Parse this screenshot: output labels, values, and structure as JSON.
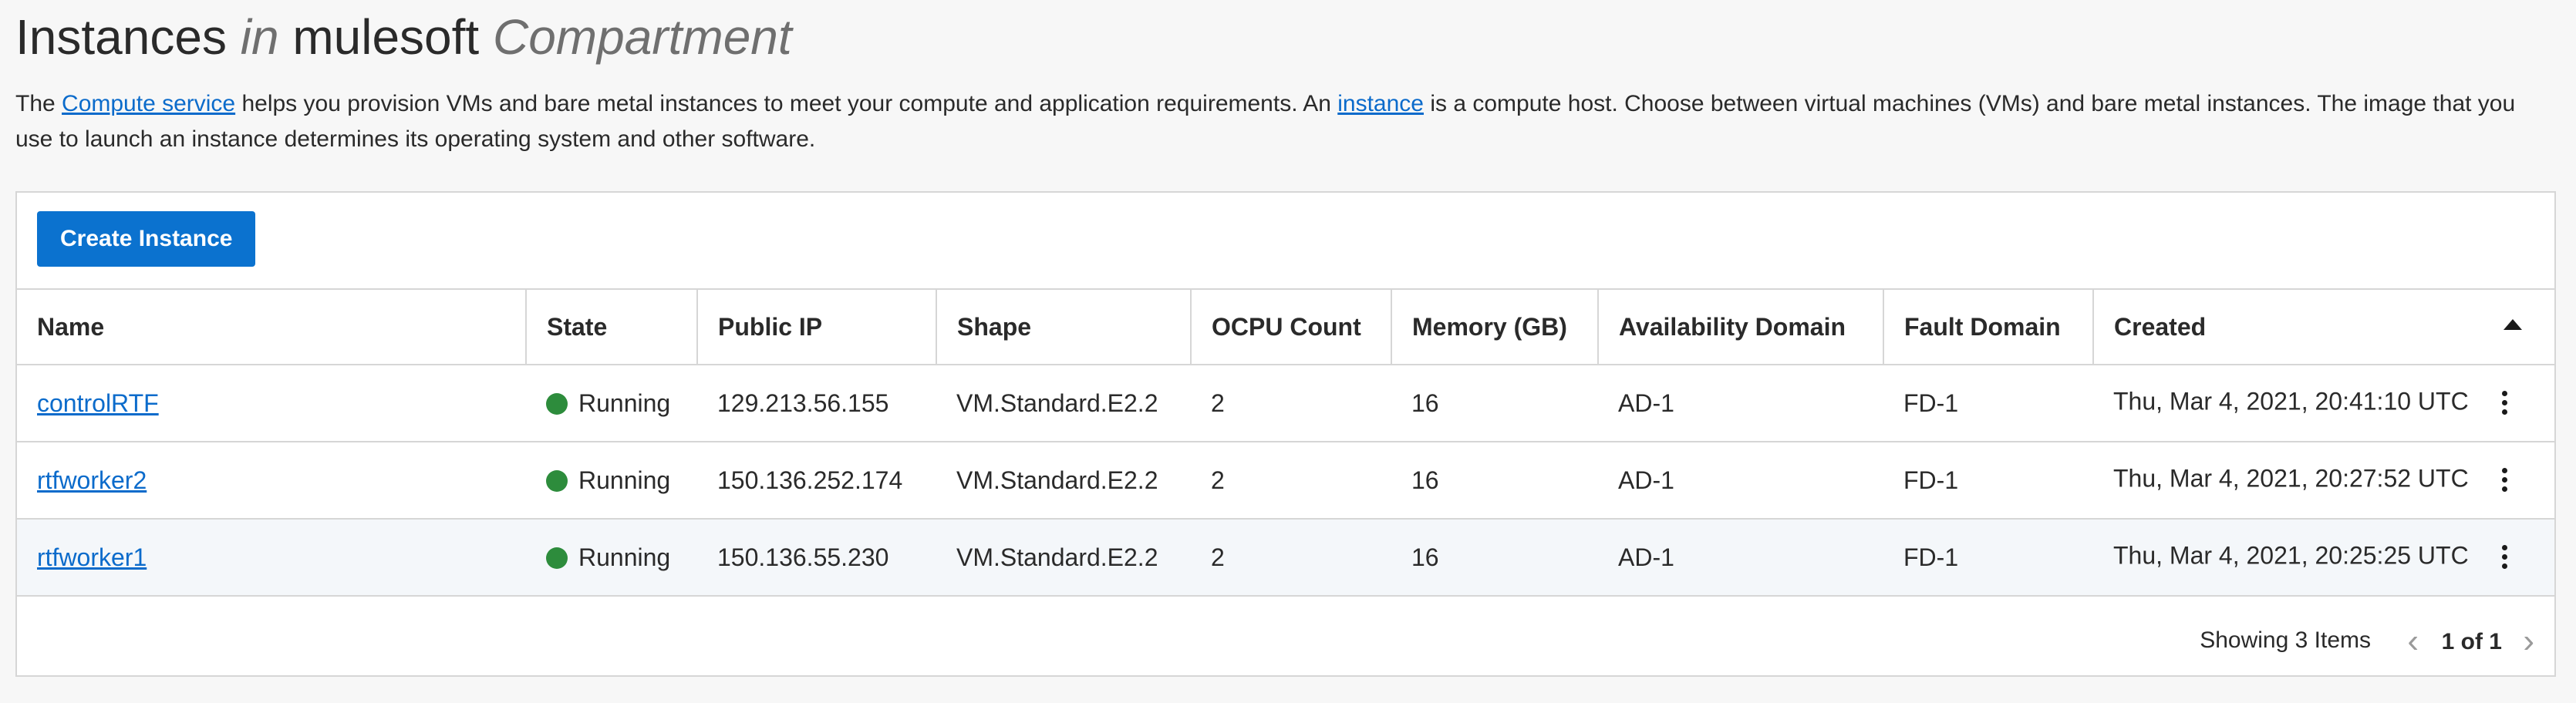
{
  "header": {
    "title_part1": "Instances ",
    "title_in": "in",
    "title_part2": " mulesoft ",
    "title_compartment": "Compartment"
  },
  "intro": {
    "text_1": "The ",
    "link_compute": "Compute service",
    "text_2": " helps you provision VMs and bare metal instances to meet your compute and application requirements. An ",
    "link_instance": "instance",
    "text_3": " is a compute host. Choose between virtual machines (VMs) and bare metal instances. The image that you use to launch an instance determines its operating system and other software."
  },
  "toolbar": {
    "create_label": "Create Instance"
  },
  "table": {
    "columns": [
      "Name",
      "State",
      "Public IP",
      "Shape",
      "OCPU Count",
      "Memory (GB)",
      "Availability Domain",
      "Fault Domain",
      "Created"
    ],
    "rows": [
      {
        "name": "controlRTF",
        "state": "Running",
        "public_ip": "129.213.56.155",
        "shape": "VM.Standard.E2.2",
        "ocpu": "2",
        "memory": "16",
        "ad": "AD-1",
        "fd": "FD-1",
        "created": "Thu, Mar 4, 2021, 20:41:10 UTC"
      },
      {
        "name": "rtfworker2",
        "state": "Running",
        "public_ip": "150.136.252.174",
        "shape": "VM.Standard.E2.2",
        "ocpu": "2",
        "memory": "16",
        "ad": "AD-1",
        "fd": "FD-1",
        "created": "Thu, Mar 4, 2021, 20:27:52 UTC"
      },
      {
        "name": "rtfworker1",
        "state": "Running",
        "public_ip": "150.136.55.230",
        "shape": "VM.Standard.E2.2",
        "ocpu": "2",
        "memory": "16",
        "ad": "AD-1",
        "fd": "FD-1",
        "created": "Thu, Mar 4, 2021, 20:25:25 UTC"
      }
    ]
  },
  "footer": {
    "showing": "Showing 3 Items",
    "page_label": "1 of 1"
  },
  "colors": {
    "primary_button": "#0b72cf",
    "link": "#0b6bcb",
    "status_running": "#2d8c3c"
  },
  "icons": {
    "sort": "sort-ascending-icon",
    "row_menu": "kebab-menu-icon",
    "status": "status-dot-icon",
    "prev": "chevron-left-icon",
    "next": "chevron-right-icon"
  }
}
